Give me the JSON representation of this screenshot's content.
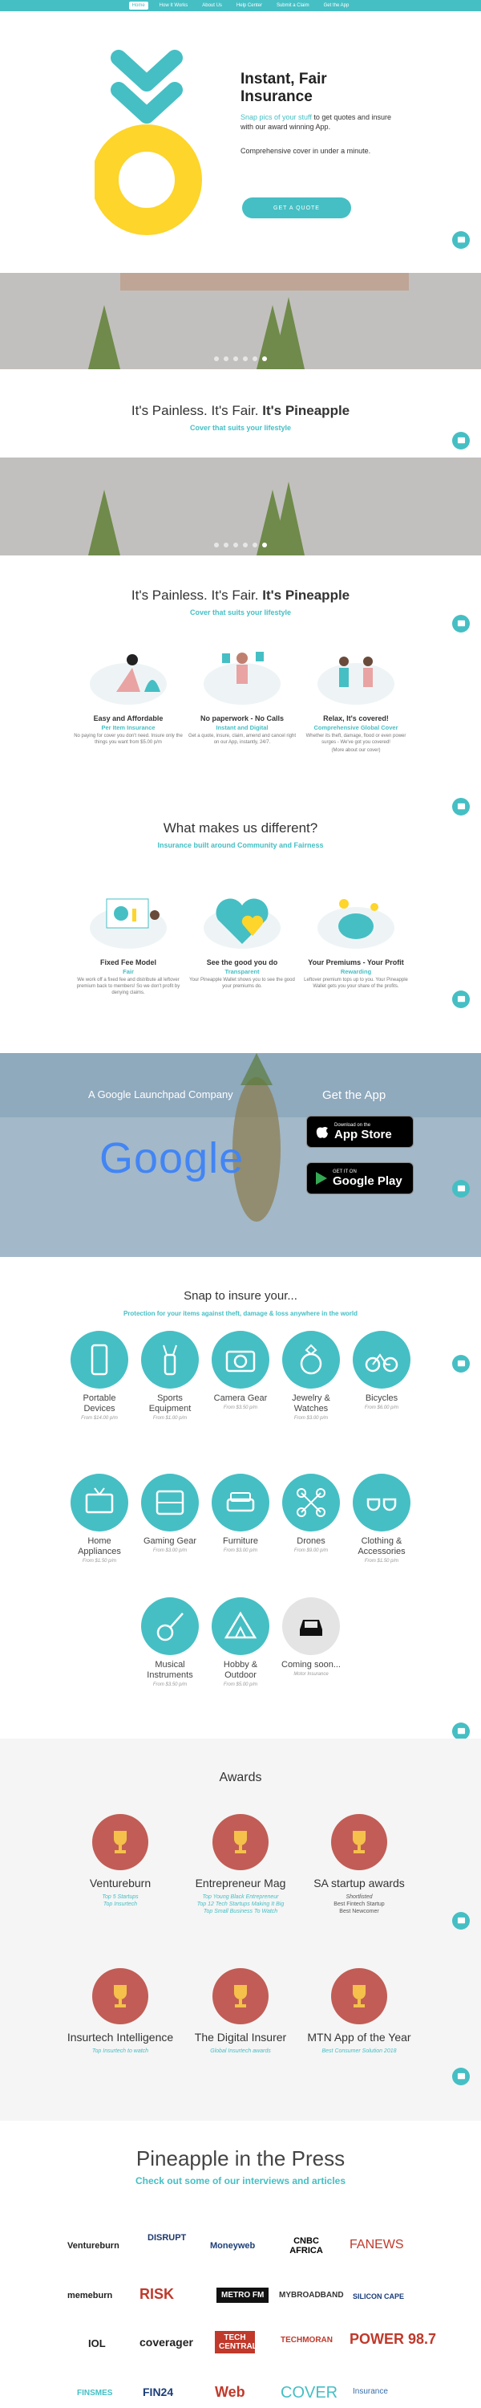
{
  "nav": {
    "items": [
      "Home",
      "How It Works",
      "About Us",
      "Help Center",
      "Submit a Claim",
      "Get the App"
    ]
  },
  "hero": {
    "title": "Instant, Fair Insurance",
    "lead_teal": "Snap pics of your stuff",
    "lead_rest": " to get quotes and insure with our award winning App.",
    "cover": "Comprehensive cover in under a minute.",
    "cta": "GET A QUOTE"
  },
  "slogan": {
    "prefix": "It's Painless. It's Fair.",
    "strong": "It's Pineapple",
    "sub": "Cover that suits your lifestyle"
  },
  "features": [
    {
      "title": "Easy and Affordable",
      "sub": "Per Item Insurance",
      "body": "No paying for cover you don't need. Insure only the things you want from $5.00 p/m"
    },
    {
      "title": "No paperwork - No Calls",
      "sub": "Instant and Digital",
      "body": "Get a quote, insure, claim, amend and cancel right on our App, instantly, 24/7."
    },
    {
      "title": "Relax, It's covered!",
      "sub": "Comprehensive Global Cover",
      "body": "Whether its theft, damage, flood or even power surges - We've got you covered!",
      "link": "(More about our cover)"
    }
  ],
  "different": {
    "title": "What makes us different?",
    "sub": "Insurance built around Community and Fairness",
    "items": [
      {
        "title": "Fixed Fee Model",
        "sub": "Fair",
        "body": "We work off a fixed fee and distribute all leftover premium back to members! So we don't profit by denying claims."
      },
      {
        "title": "See the good you do",
        "sub": "Transparent",
        "body": "Your Pineapple Wallet shows you to see the good your premiums do."
      },
      {
        "title": "Your Premiums - Your Profit",
        "sub": "Rewarding",
        "body": "Leftover premium tops up to you. Your Pineapple Wallet gets you your share of the profits."
      }
    ]
  },
  "launchpad": {
    "company": "A Google Launchpad Company",
    "google": "Google",
    "get_app": "Get the App",
    "appstore_small": "Download on the",
    "appstore_big": "App Store",
    "gplay_small": "GET IT ON",
    "gplay_big": "Google Play"
  },
  "snap": {
    "title": "Snap to insure your...",
    "sub": "Protection for your items against theft, damage & loss anywhere in the world",
    "items": [
      {
        "name": "Portable Devices",
        "price": "From $14.00 p/m",
        "icon": "phone-icon"
      },
      {
        "name": "Sports Equipment",
        "price": "From $1.00 p/m",
        "icon": "golf-bag-icon"
      },
      {
        "name": "Camera Gear",
        "price": "From $3.50 p/m",
        "icon": "camera-icon"
      },
      {
        "name": "Jewelry & Watches",
        "price": "From $3.00 p/m",
        "icon": "ring-icon"
      },
      {
        "name": "Bicycles",
        "price": "From $6.00 p/m",
        "icon": "bicycle-icon"
      },
      {
        "name": "Home Appliances",
        "price": "From $1.50 p/m",
        "icon": "tv-icon"
      },
      {
        "name": "Gaming Gear",
        "price": "From $3.00 p/m",
        "icon": "game-console-icon"
      },
      {
        "name": "Furniture",
        "price": "From $3.00 p/m",
        "icon": "couch-icon"
      },
      {
        "name": "Drones",
        "price": "From $9.00 p/m",
        "icon": "drone-icon"
      },
      {
        "name": "Clothing & Accessories",
        "price": "From $1.50 p/m",
        "icon": "sunglasses-icon"
      },
      {
        "name": "Musical Instruments",
        "price": "From $3.50 p/m",
        "icon": "guitar-icon"
      },
      {
        "name": "Hobby & Outdoor",
        "price": "From $5.00 p/m",
        "icon": "tent-icon"
      },
      {
        "name": "Coming soon...",
        "price": "Motor Insurance",
        "icon": "car-icon"
      }
    ]
  },
  "awards": {
    "title": "Awards",
    "items": [
      {
        "name": "Ventureburn",
        "desc": [
          "Top 5 Startups",
          "Top Insurtech"
        ],
        "grey": []
      },
      {
        "name": "Entrepreneur Mag",
        "desc": [
          "Top Young Black Entrepreneur",
          "Top 12 Tech Startups Making It Big",
          "Top Small Business To Watch"
        ],
        "grey": []
      },
      {
        "name": "SA startup awards",
        "desc": [
          "Shortlisted"
        ],
        "grey": [
          "Best Fintech Startup",
          "Best Newcomer"
        ]
      },
      {
        "name": "Insurtech Intelligence",
        "desc": [
          "Top Insurtech to watch"
        ],
        "grey": []
      },
      {
        "name": "The Digital Insurer",
        "desc": [
          "Global Insurtech awards"
        ],
        "grey": []
      },
      {
        "name": "MTN App of the Year",
        "desc": [
          "Best Consumer Solution 2018"
        ],
        "grey": []
      }
    ]
  },
  "press": {
    "title": "Pineapple in the Press",
    "sub": "Check out some of our interviews and articles",
    "logos": [
      "Ventureburn",
      "DISRUPT",
      "Moneyweb",
      "CNBC AFRICA",
      "FANEWS",
      "memeburn",
      "RISK",
      "METRO FM",
      "MYBROADBAND",
      "SILICON CAPE",
      "IOL",
      "coverager",
      "TECH CENTRAL",
      "TECHMORAN",
      "POWER 98.7",
      "FINSMES",
      "FIN24",
      "Web",
      "COVER",
      "Insurance"
    ]
  },
  "colors": {
    "teal": "#45bfc4",
    "yellow": "#fdd52b",
    "award_red": "#c15d56"
  }
}
